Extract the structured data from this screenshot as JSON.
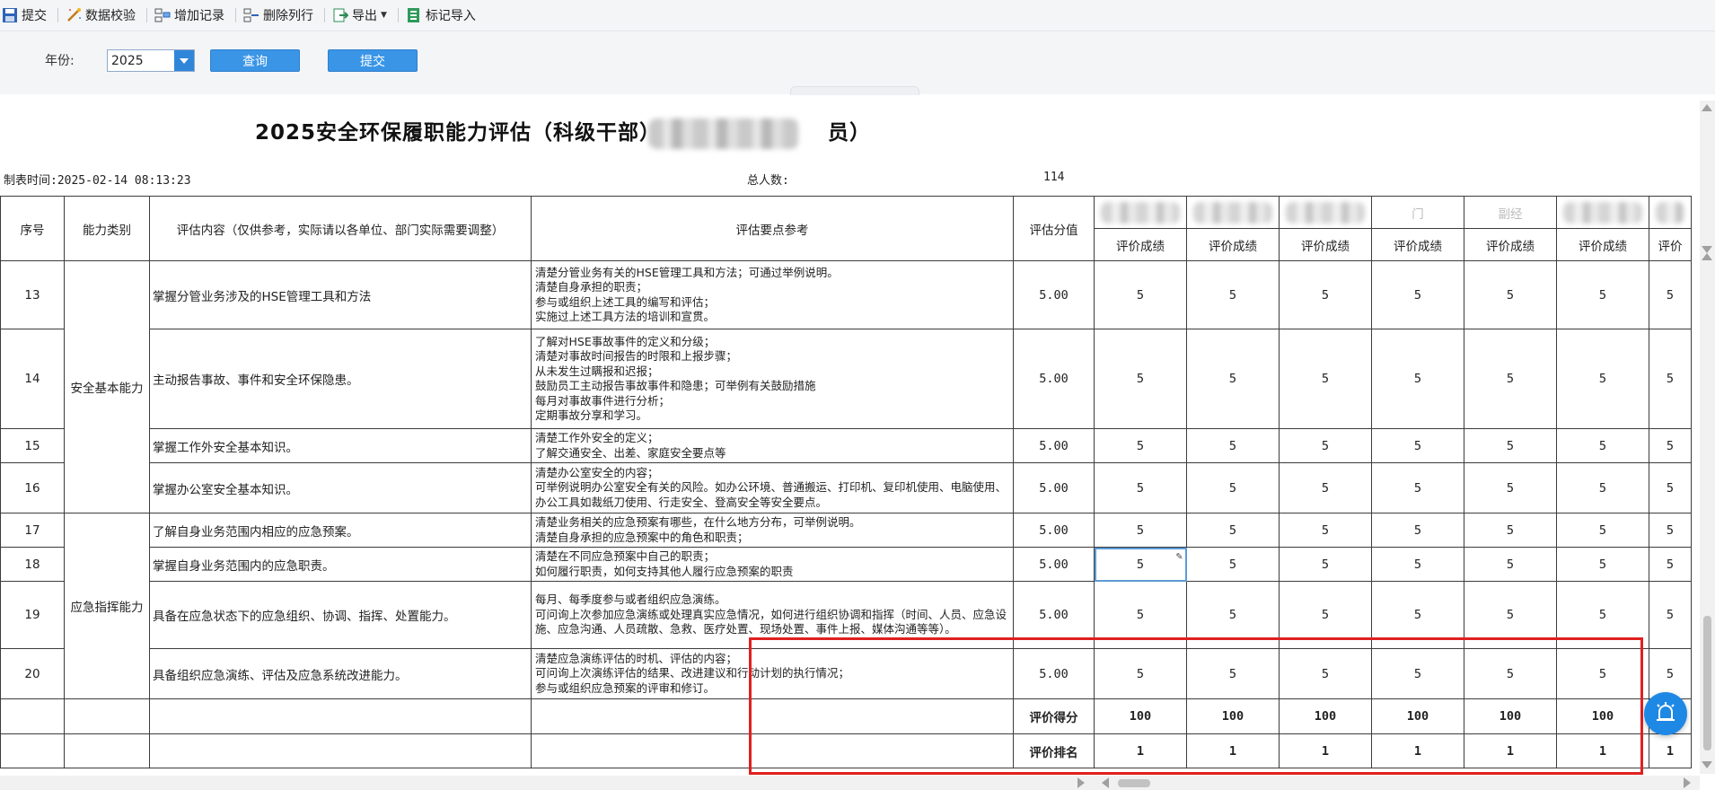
{
  "toolbar": [
    {
      "label": "提交",
      "icon": "save-icon"
    },
    {
      "label": "数据校验",
      "icon": "wand-icon"
    },
    {
      "label": "增加记录",
      "icon": "add-row-icon"
    },
    {
      "label": "删除列行",
      "icon": "delete-row-icon"
    },
    {
      "label": "导出",
      "icon": "export-icon"
    },
    {
      "label": "标记导入",
      "icon": "import-icon"
    }
  ],
  "filter": {
    "year_label": "年份:",
    "year_value": "2025",
    "query_button": "查询",
    "submit_button": "提交"
  },
  "report": {
    "title_prefix": "2025安全环保履职能力评估（科级干部）",
    "title_suffix": "员）",
    "created_label": "制表时间:",
    "created_value": "2025-02-14 08:13:23",
    "total_label": "总人数:",
    "total_value": "114"
  },
  "table": {
    "headers": {
      "seq": "序号",
      "category": "能力类别",
      "content": "评估内容（仅供参考，实际请以各单位、部门实际需要调整）",
      "points": "评估要点参考",
      "score": "评估分值",
      "group_partial_1": "门",
      "group_partial_2": "副经",
      "sub": "评价成绩",
      "sub_partial": "评价"
    },
    "rows": [
      {
        "seq": "13",
        "content": "掌握分管业务涉及的HSE管理工具和方法",
        "points": "清楚分管业务有关的HSE管理工具和方法；可通过举例说明。\n清楚自身承担的职责；\n参与或组织上述工具的编写和评估；\n实施过上述工具方法的培训和宣贯。",
        "score": "5.00",
        "grades": [
          "5",
          "5",
          "5",
          "5",
          "5",
          "5",
          "5"
        ]
      },
      {
        "seq": "14",
        "content": "主动报告事故、事件和安全环保隐患。",
        "points": "了解对HSE事故事件的定义和分级；\n清楚对事故时间报告的时限和上报步骤；\n从未发生过瞒报和迟报；\n鼓励员工主动报告事故事件和隐患；可举例有关鼓励措施\n每月对事故事件进行分析；\n定期事故分享和学习。",
        "score": "5.00",
        "grades": [
          "5",
          "5",
          "5",
          "5",
          "5",
          "5",
          "5"
        ]
      },
      {
        "seq": "15",
        "content": "掌握工作外安全基本知识。",
        "points": "清楚工作外安全的定义；\n了解交通安全、出差、家庭安全要点等",
        "score": "5.00",
        "grades": [
          "5",
          "5",
          "5",
          "5",
          "5",
          "5",
          "5"
        ]
      },
      {
        "seq": "16",
        "content": "掌握办公室安全基本知识。",
        "points": "清楚办公室安全的内容；\n可举例说明办公室安全有关的风险。如办公环境、普通搬运、打印机、复印机使用、电脑使用、办公工具如裁纸刀使用、行走安全、登高安全等安全要点。",
        "score": "5.00",
        "grades": [
          "5",
          "5",
          "5",
          "5",
          "5",
          "5",
          "5"
        ]
      },
      {
        "seq": "17",
        "content": "了解自身业务范围内相应的应急预案。",
        "points": "清楚业务相关的应急预案有哪些，在什么地方分布，可举例说明。\n清楚自身承担的应急预案中的角色和职责；",
        "score": "5.00",
        "grades": [
          "5",
          "5",
          "5",
          "5",
          "5",
          "5",
          "5"
        ]
      },
      {
        "seq": "18",
        "content": "掌握自身业务范围内的应急职责。",
        "points": "清楚在不同应急预案中自己的职责；\n如何履行职责，如何支持其他人履行应急预案的职责",
        "score": "5.00",
        "grades": [
          "5",
          "5",
          "5",
          "5",
          "5",
          "5",
          "5"
        ]
      },
      {
        "seq": "19",
        "content": "具备在应急状态下的应急组织、协调、指挥、处置能力。",
        "points": "每月、每季度参与或者组织应急演练。\n可问询上次参加应急演练或处理真实应急情况，如何进行组织协调和指挥（时间、人员、应急设施、应急沟通、人员疏散、急救、医疗处置、现场处置、事件上报、媒体沟通等等）。",
        "score": "5.00",
        "grades": [
          "5",
          "5",
          "5",
          "5",
          "5",
          "5",
          "5"
        ]
      },
      {
        "seq": "20",
        "content": "具备组织应急演练、评估及应急系统改进能力。",
        "points": "清楚应急演练评估的时机、评估的内容；\n可问询上次演练评估的结果、改进建议和行动计划的执行情况；\n参与或组织应急预案的评审和修订。",
        "score": "5.00",
        "grades": [
          "5",
          "5",
          "5",
          "5",
          "5",
          "5",
          "5"
        ]
      }
    ],
    "categories": [
      "安全基本能力",
      "应急指挥能力"
    ],
    "summary": [
      {
        "label": "评价得分",
        "values": [
          "100",
          "100",
          "100",
          "100",
          "100",
          "100",
          "10"
        ]
      },
      {
        "label": "评价排名",
        "values": [
          "1",
          "1",
          "1",
          "1",
          "1",
          "1",
          "1"
        ]
      }
    ]
  }
}
